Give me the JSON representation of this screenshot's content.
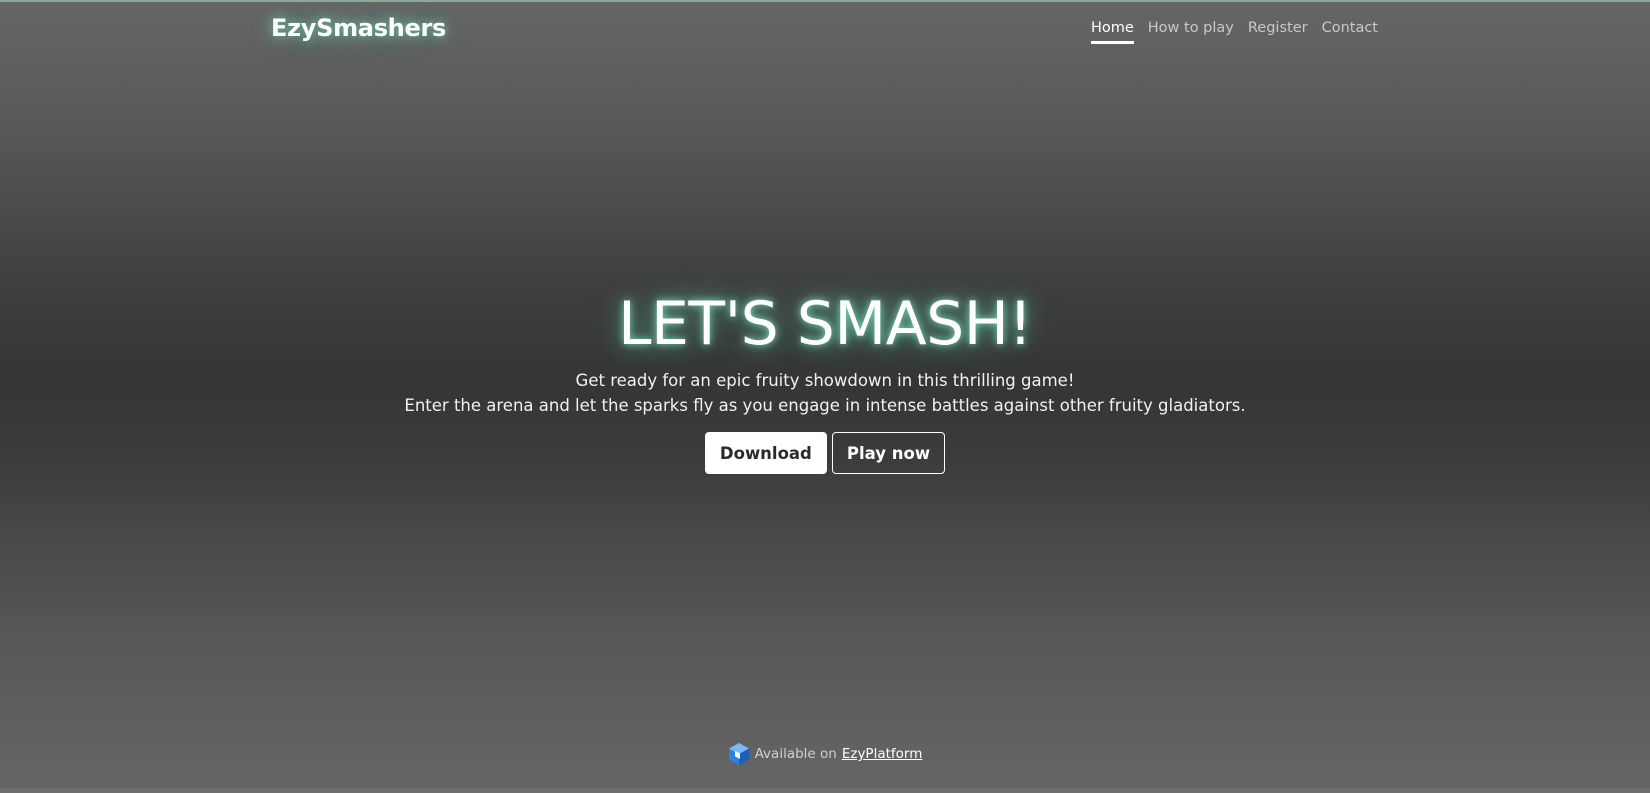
{
  "brand": {
    "name": "EzySmashers",
    "glow_color": "#7effd2"
  },
  "nav": {
    "items": [
      {
        "label": "Home",
        "active": true
      },
      {
        "label": "How to play",
        "active": false
      },
      {
        "label": "Register",
        "active": false
      },
      {
        "label": "Contact",
        "active": false
      }
    ]
  },
  "hero": {
    "title": "LET'S SMASH!",
    "line1": "Get ready for an epic fruity showdown in this thrilling game!",
    "line2": "Enter the arena and let the sparks fly as you engage in intense battles against other fruity gladiators.",
    "download_label": "Download",
    "play_label": "Play now"
  },
  "footer": {
    "available_text": "Available on",
    "platform_link": "EzyPlatform",
    "logo_icon": "ezyplatform-cube-icon"
  },
  "colors": {
    "background_edge": "#666666",
    "background_center": "#353535",
    "accent_glow": "#7effd2",
    "logo_blue": "#2f7fe0"
  }
}
